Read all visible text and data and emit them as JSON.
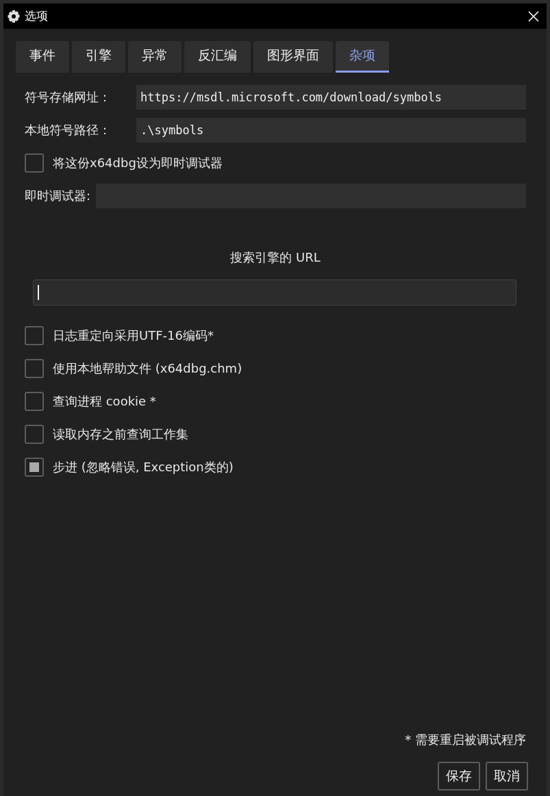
{
  "window": {
    "title": "选项"
  },
  "tabs": [
    {
      "label": "事件",
      "selected": false
    },
    {
      "label": "引擎",
      "selected": false
    },
    {
      "label": "异常",
      "selected": false
    },
    {
      "label": "反汇编",
      "selected": false
    },
    {
      "label": "图形界面",
      "selected": false
    },
    {
      "label": "杂项",
      "selected": true
    }
  ],
  "fields": [
    {
      "label": "符号存储网址：",
      "value": "https://msdl.microsoft.com/download/symbols"
    },
    {
      "label": "本地符号路径：",
      "value": ".\\symbols"
    }
  ],
  "jit_checkbox": {
    "label": "将这份x64dbg设为即时调试器",
    "checked": false,
    "partial": false
  },
  "jit_field": {
    "label": "即时调试器:"
  },
  "search_engine": {
    "heading": "搜索引擎的 URL"
  },
  "options": [
    {
      "label": "日志重定向采用UTF-16编码*",
      "checked": false,
      "partial": false
    },
    {
      "label": "使用本地帮助文件 (x64dbg.chm)",
      "checked": false,
      "partial": false
    },
    {
      "label": "查询进程 cookie *",
      "checked": false,
      "partial": false
    },
    {
      "label": "读取内存之前查询工作集",
      "checked": false,
      "partial": false
    },
    {
      "label": "步进 (忽略错误, Exception类的)",
      "checked": false,
      "partial": true
    }
  ],
  "footnote": "* 需要重启被调试程序",
  "buttons": [
    "保存",
    "取消"
  ]
}
